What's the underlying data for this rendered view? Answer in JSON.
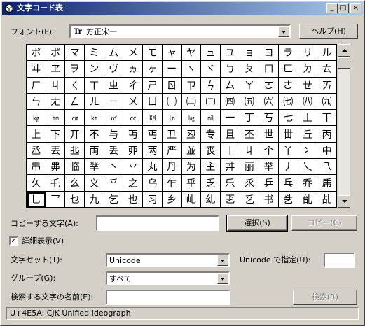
{
  "window": {
    "title": "文字コード表"
  },
  "title_buttons": {
    "minimize": "_",
    "maximize": "□",
    "close": "×"
  },
  "font": {
    "label": "フォント(F):",
    "icon_text": "Tr",
    "value": "方正宋一"
  },
  "help_button": "ヘルプ(H)",
  "char_rows": [
    [
      "ポ",
      "ポ",
      "マ",
      "ミ",
      "ム",
      "メ",
      "モ",
      "ャ",
      "ヤ",
      "ュ",
      "ユ",
      "ョ",
      "ヨ",
      "ラ",
      "リ",
      "ル",
      "レ",
      "ロ",
      "ワ"
    ],
    [
      "ヰ",
      "ヱ",
      "ヲ",
      "ン",
      "ヴ",
      "ヵ",
      "ヶ",
      "ー",
      "ヽ",
      "ヾ",
      "ㄅ",
      "ㄆ",
      "ㄇ",
      "ㄈ",
      "ㄉ",
      "ㄊ",
      "ㄋ",
      "ㄌ",
      "ㄍ"
    ],
    [
      "ㄏ",
      "ㄐ",
      "ㄑ",
      "ㄒ",
      "ㄓ",
      "ㄔ",
      "ㄕ",
      "ㄖ",
      "ㄗ",
      "ㄘ",
      "ㄙ",
      "ㄚ",
      "ㄛ",
      "ㄜ",
      "ㄝ",
      "ㄞ",
      "ㄟ",
      "ㄠ",
      "ㄡ"
    ],
    [
      "ㄣ",
      "ㄤ",
      "ㄥ",
      "ㄦ",
      "ㄧ",
      "ㄨ",
      "ㄩ",
      "㈠",
      "㈡",
      "㈢",
      "㈣",
      "㈤",
      "㈥",
      "㈦",
      "㈧",
      "㈨",
      "㈩",
      "㊣",
      "㎎"
    ],
    [
      "㎏",
      "㎜",
      "㎝",
      "㎞",
      "㎡",
      "㏄",
      "㏎",
      "㏑",
      "㏒",
      "㏕",
      "一",
      "丁",
      "丂",
      "七",
      "丄",
      "丅",
      "丆",
      "万",
      "丈"
    ],
    [
      "上",
      "下",
      "丌",
      "不",
      "与",
      "丏",
      "丐",
      "丑",
      "丒",
      "专",
      "且",
      "丕",
      "世",
      "丗",
      "丘",
      "丙",
      "业",
      "丛",
      "东"
    ],
    [
      "丞",
      "丟",
      "丠",
      "両",
      "丢",
      "丣",
      "两",
      "严",
      "並",
      "丧",
      "丨",
      "丩",
      "个",
      "丫",
      "丬",
      "中",
      "丮",
      "丯",
      "丰"
    ],
    [
      "串",
      "丳",
      "临",
      "丵",
      "丶",
      "丷",
      "丸",
      "丹",
      "为",
      "主",
      "丼",
      "丽",
      "举",
      "丿",
      "乀",
      "乁",
      "乂",
      "乃",
      "乄"
    ],
    [
      "久",
      "乇",
      "么",
      "义",
      "乊",
      "之",
      "乌",
      "乍",
      "乎",
      "乏",
      "乐",
      "乑",
      "乒",
      "乓",
      "乔",
      "乕",
      "乖",
      "乗",
      "乘"
    ],
    [
      "乚",
      "乛",
      "乜",
      "九",
      "乞",
      "也",
      "习",
      "乡",
      "乢",
      "乣",
      "乤",
      "乥",
      "书",
      "乧",
      "乨",
      "乩",
      "乪",
      "乫",
      "乬"
    ]
  ],
  "selected_char": "乚",
  "copy": {
    "label": "コピーする文字(A):",
    "value": "",
    "select_button": "選択(S)",
    "copy_button": "コピー(C)"
  },
  "advanced": {
    "label": "詳細表示(V)",
    "checked": "✓"
  },
  "charset": {
    "label": "文字セット(T):",
    "value": "Unicode"
  },
  "unicode_goto": {
    "label": "Unicode で指定(U):",
    "value": ""
  },
  "group": {
    "label": "グループ(G):",
    "value": "すべて"
  },
  "search": {
    "label": "検索する文字の名前(E):",
    "value": "",
    "button": "検索(R)"
  },
  "status": "U+4E5A: CJK Unified Ideograph"
}
